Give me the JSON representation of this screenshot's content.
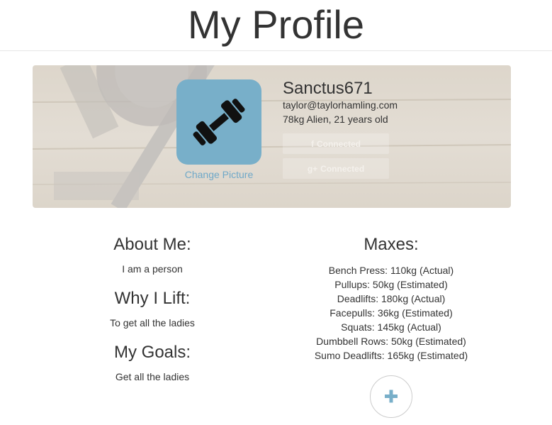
{
  "page": {
    "title": "My Profile"
  },
  "profile": {
    "change_picture_label": "Change Picture",
    "username": "Sanctus671",
    "email": "taylor@taylorhamling.com",
    "stats": "78kg Alien, 21 years old",
    "avatar_icon": "dumbbell-icon",
    "facebook_button": {
      "icon": "f",
      "label": "Connected"
    },
    "google_button": {
      "icon": "g+",
      "label": "Connected"
    }
  },
  "about": {
    "about_heading": "About Me:",
    "about_text": "I am a person",
    "why_heading": "Why I Lift:",
    "why_text": "To get all the ladies",
    "goals_heading": "My Goals:",
    "goals_text": "Get all the ladies"
  },
  "maxes": {
    "heading": "Maxes:",
    "items": [
      "Bench Press: 110kg (Actual)",
      "Pullups: 50kg (Estimated)",
      "Deadlifts: 180kg (Actual)",
      "Facepulls: 36kg (Estimated)",
      "Squats: 145kg (Actual)",
      "Dumbbell Rows: 50kg (Estimated)",
      "Sumo Deadlifts: 165kg (Estimated)"
    ],
    "add_icon": "plus-icon"
  },
  "colors": {
    "accent": "#78afc9",
    "link": "#6fa8c8",
    "text": "#333333"
  }
}
